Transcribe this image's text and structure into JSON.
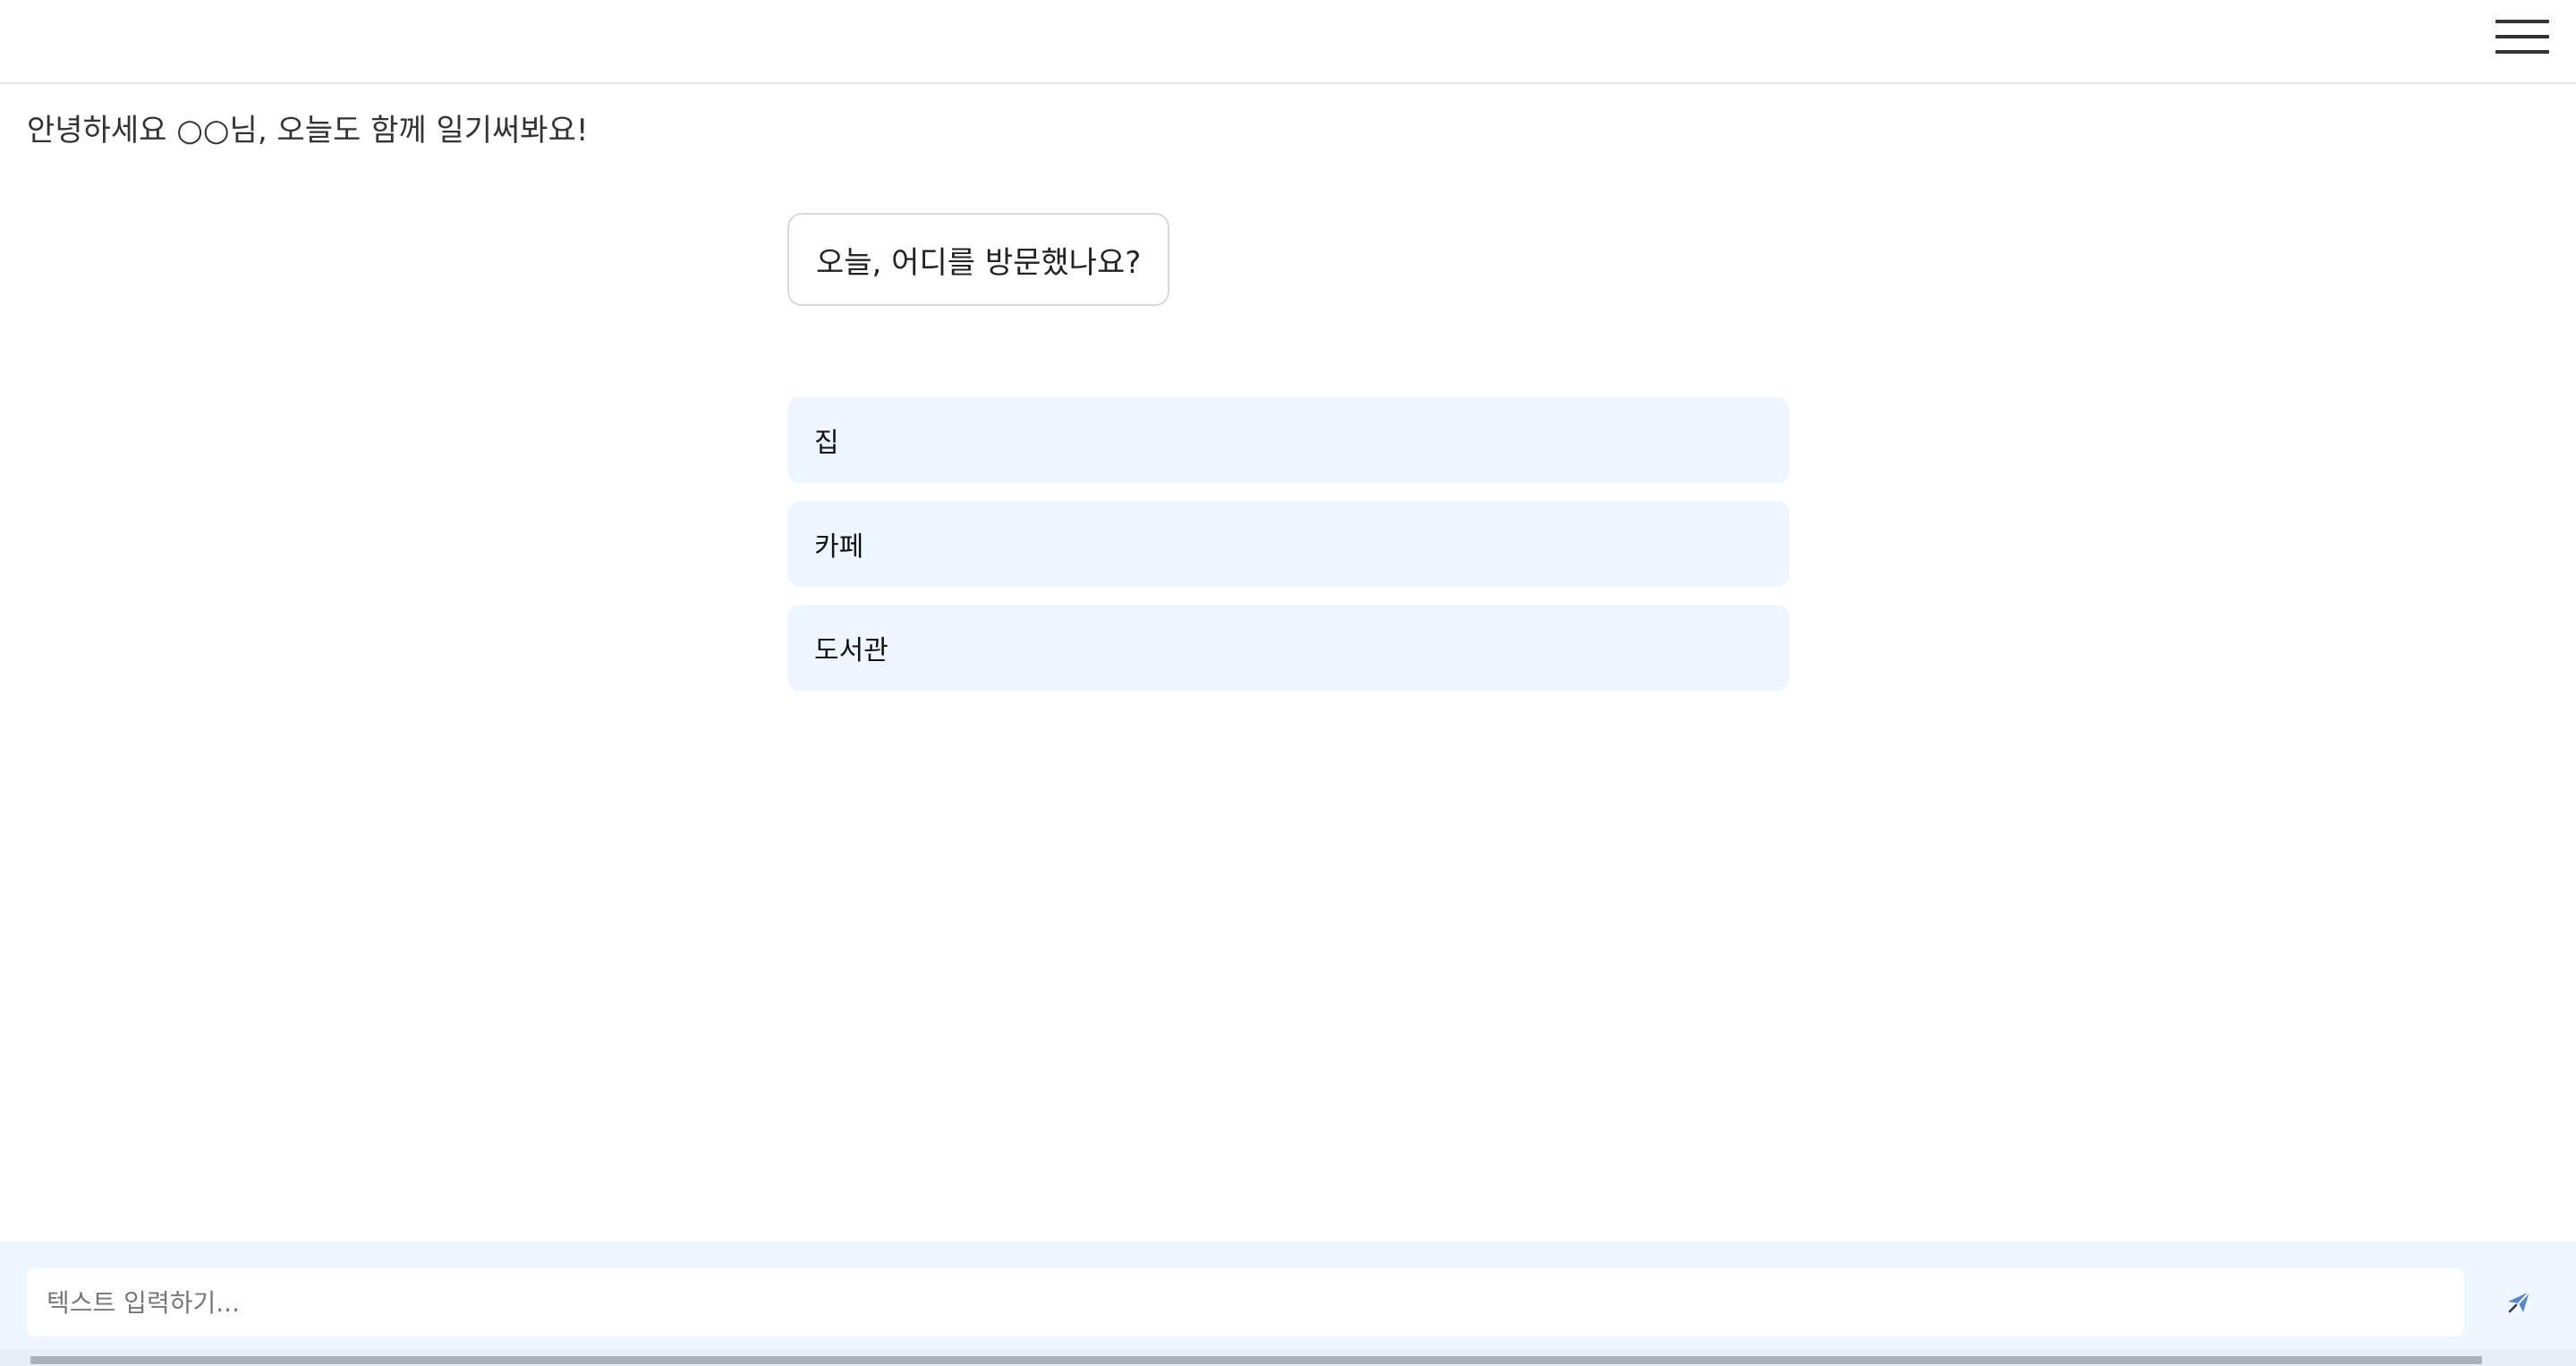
{
  "header": {
    "menu_icon": "hamburger-menu-icon"
  },
  "greeting": "안녕하세요 ○○님, 오늘도 함께 일기써봐요!",
  "question": "오늘, 어디를 방문했나요?",
  "options": [
    {
      "label": "집"
    },
    {
      "label": "카페"
    },
    {
      "label": "도서관"
    }
  ],
  "input": {
    "placeholder": "텍스트 입력하기...",
    "value": "",
    "send_icon": "paper-plane-send-icon"
  },
  "colors": {
    "option_bg": "#eef6ff",
    "input_bar_bg": "#eef6ff",
    "send_icon": "#5a86c5"
  }
}
